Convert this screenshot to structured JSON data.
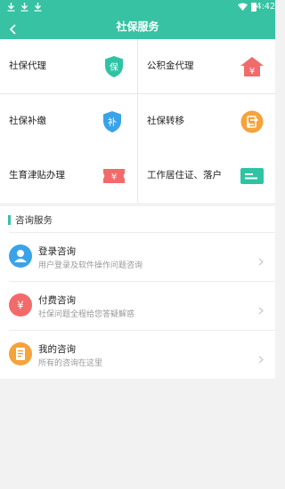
{
  "status_bar": {
    "time": "4:42",
    "icons": [
      "download-icon",
      "download-icon",
      "download-icon",
      "wifi-icon",
      "battery-icon"
    ]
  },
  "header": {
    "title": "社保服务",
    "back_icon": "chevron-left-icon"
  },
  "services": [
    {
      "label": "社保代理",
      "icon_text": "保",
      "icon": "shield-icon",
      "color": "#2fc3a3"
    },
    {
      "label": "公积金代理",
      "icon_text": "¥",
      "icon": "house-icon",
      "color": "#f26b6b"
    },
    {
      "label": "社保补缴",
      "icon_text": "补",
      "icon": "shield-icon",
      "color": "#3aa3e8"
    },
    {
      "label": "社保转移",
      "icon_text": "",
      "icon": "transfer-icon",
      "color": "#f5a33b"
    },
    {
      "label": "生育津贴办理",
      "icon_text": "¥",
      "icon": "ticket-icon",
      "color": "#f26b6b"
    },
    {
      "label": "工作居住证、落户",
      "icon_text": "",
      "icon": "card-icon",
      "color": "#2fc3a3"
    }
  ],
  "consult": {
    "title": "咨询服务",
    "items": [
      {
        "title": "登录咨询",
        "subtitle": "用户登录及软件操作问题咨询",
        "icon": "user-icon",
        "color": "#3aa3e8"
      },
      {
        "title": "付费咨询",
        "subtitle": "社保问题全程给您答疑解惑",
        "icon": "yen-icon",
        "color": "#f26b6b"
      },
      {
        "title": "我的咨询",
        "subtitle": "所有的咨询在这里",
        "icon": "document-icon",
        "color": "#f5a33b"
      }
    ]
  }
}
